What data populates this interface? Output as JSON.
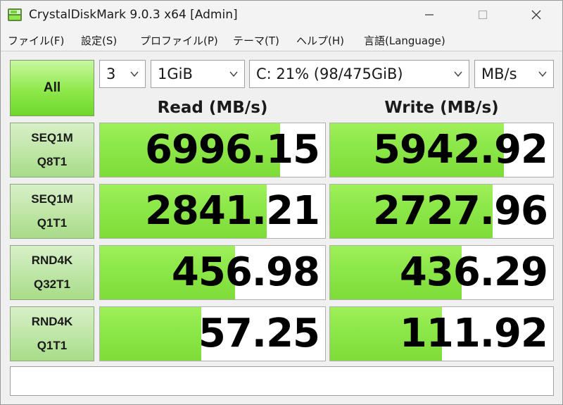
{
  "window": {
    "title": "CrystalDiskMark 9.0.3 x64 [Admin]",
    "icon": "crystaldiskmark-app-icon"
  },
  "menu": [
    {
      "label": "ファイル(F)"
    },
    {
      "label": "設定(S)"
    },
    {
      "label": "プロファイル(P)"
    },
    {
      "label": "テーマ(T)"
    },
    {
      "label": "ヘルプ(H)"
    },
    {
      "label": "言語(Language)"
    }
  ],
  "controls": {
    "all_label": "All",
    "count": "3",
    "size": "1GiB",
    "drive": "C: 21% (98/475GiB)",
    "unit": "MB/s"
  },
  "headers": {
    "read": "Read (MB/s)",
    "write": "Write (MB/s)"
  },
  "tests": [
    {
      "line1": "SEQ1M",
      "line2": "Q8T1",
      "read": "6996.15",
      "write": "5942.92",
      "read_fill": 0.8,
      "write_fill": 0.78
    },
    {
      "line1": "SEQ1M",
      "line2": "Q1T1",
      "read": "2841.21",
      "write": "2727.96",
      "read_fill": 0.74,
      "write_fill": 0.73
    },
    {
      "line1": "RND4K",
      "line2": "Q32T1",
      "read": "456.98",
      "write": "436.29",
      "read_fill": 0.6,
      "write_fill": 0.59
    },
    {
      "line1": "RND4K",
      "line2": "Q1T1",
      "read": "57.25",
      "write": "111.92",
      "read_fill": 0.45,
      "write_fill": 0.5
    }
  ],
  "comment": "",
  "colors": {
    "bar_green": "#8ee84a",
    "label_green": "#a8dc88"
  }
}
